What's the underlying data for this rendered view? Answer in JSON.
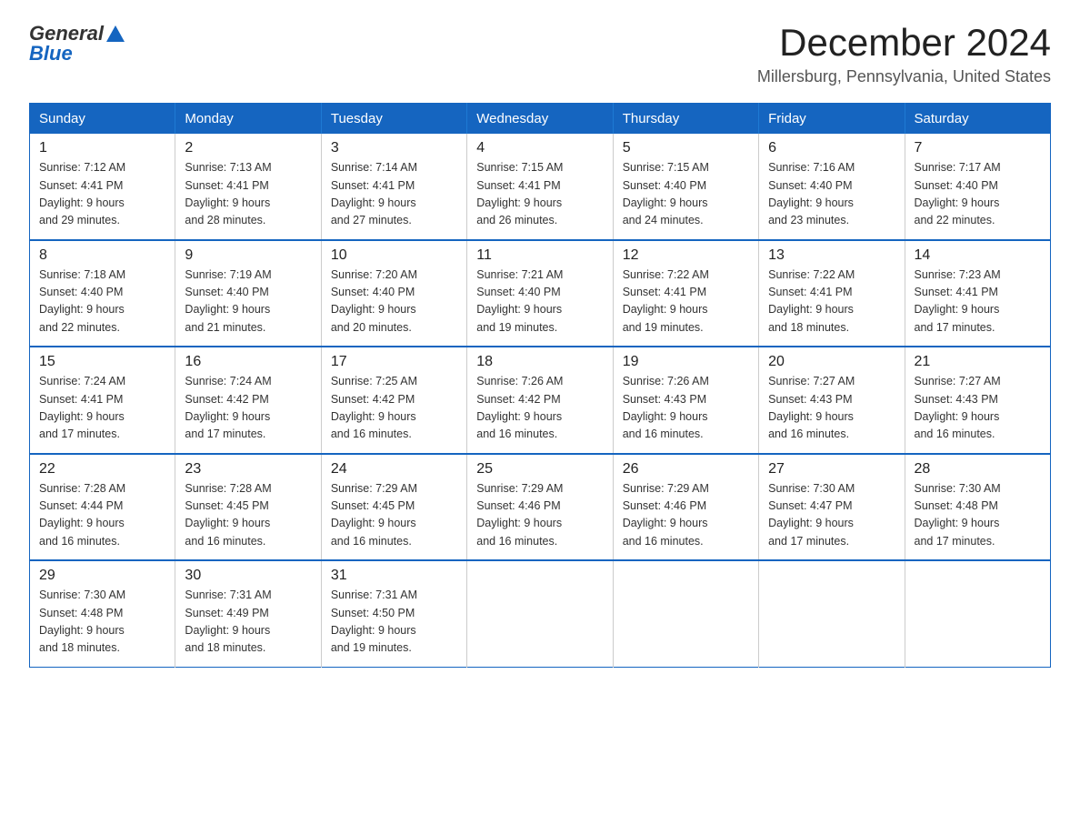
{
  "header": {
    "logo_text_general": "General",
    "logo_text_blue": "Blue",
    "title": "December 2024",
    "subtitle": "Millersburg, Pennsylvania, United States"
  },
  "days_of_week": [
    "Sunday",
    "Monday",
    "Tuesday",
    "Wednesday",
    "Thursday",
    "Friday",
    "Saturday"
  ],
  "weeks": [
    [
      {
        "day": "1",
        "sunrise": "7:12 AM",
        "sunset": "4:41 PM",
        "daylight": "9 hours and 29 minutes."
      },
      {
        "day": "2",
        "sunrise": "7:13 AM",
        "sunset": "4:41 PM",
        "daylight": "9 hours and 28 minutes."
      },
      {
        "day": "3",
        "sunrise": "7:14 AM",
        "sunset": "4:41 PM",
        "daylight": "9 hours and 27 minutes."
      },
      {
        "day": "4",
        "sunrise": "7:15 AM",
        "sunset": "4:41 PM",
        "daylight": "9 hours and 26 minutes."
      },
      {
        "day": "5",
        "sunrise": "7:15 AM",
        "sunset": "4:40 PM",
        "daylight": "9 hours and 24 minutes."
      },
      {
        "day": "6",
        "sunrise": "7:16 AM",
        "sunset": "4:40 PM",
        "daylight": "9 hours and 23 minutes."
      },
      {
        "day": "7",
        "sunrise": "7:17 AM",
        "sunset": "4:40 PM",
        "daylight": "9 hours and 22 minutes."
      }
    ],
    [
      {
        "day": "8",
        "sunrise": "7:18 AM",
        "sunset": "4:40 PM",
        "daylight": "9 hours and 22 minutes."
      },
      {
        "day": "9",
        "sunrise": "7:19 AM",
        "sunset": "4:40 PM",
        "daylight": "9 hours and 21 minutes."
      },
      {
        "day": "10",
        "sunrise": "7:20 AM",
        "sunset": "4:40 PM",
        "daylight": "9 hours and 20 minutes."
      },
      {
        "day": "11",
        "sunrise": "7:21 AM",
        "sunset": "4:40 PM",
        "daylight": "9 hours and 19 minutes."
      },
      {
        "day": "12",
        "sunrise": "7:22 AM",
        "sunset": "4:41 PM",
        "daylight": "9 hours and 19 minutes."
      },
      {
        "day": "13",
        "sunrise": "7:22 AM",
        "sunset": "4:41 PM",
        "daylight": "9 hours and 18 minutes."
      },
      {
        "day": "14",
        "sunrise": "7:23 AM",
        "sunset": "4:41 PM",
        "daylight": "9 hours and 17 minutes."
      }
    ],
    [
      {
        "day": "15",
        "sunrise": "7:24 AM",
        "sunset": "4:41 PM",
        "daylight": "9 hours and 17 minutes."
      },
      {
        "day": "16",
        "sunrise": "7:24 AM",
        "sunset": "4:42 PM",
        "daylight": "9 hours and 17 minutes."
      },
      {
        "day": "17",
        "sunrise": "7:25 AM",
        "sunset": "4:42 PM",
        "daylight": "9 hours and 16 minutes."
      },
      {
        "day": "18",
        "sunrise": "7:26 AM",
        "sunset": "4:42 PM",
        "daylight": "9 hours and 16 minutes."
      },
      {
        "day": "19",
        "sunrise": "7:26 AM",
        "sunset": "4:43 PM",
        "daylight": "9 hours and 16 minutes."
      },
      {
        "day": "20",
        "sunrise": "7:27 AM",
        "sunset": "4:43 PM",
        "daylight": "9 hours and 16 minutes."
      },
      {
        "day": "21",
        "sunrise": "7:27 AM",
        "sunset": "4:43 PM",
        "daylight": "9 hours and 16 minutes."
      }
    ],
    [
      {
        "day": "22",
        "sunrise": "7:28 AM",
        "sunset": "4:44 PM",
        "daylight": "9 hours and 16 minutes."
      },
      {
        "day": "23",
        "sunrise": "7:28 AM",
        "sunset": "4:45 PM",
        "daylight": "9 hours and 16 minutes."
      },
      {
        "day": "24",
        "sunrise": "7:29 AM",
        "sunset": "4:45 PM",
        "daylight": "9 hours and 16 minutes."
      },
      {
        "day": "25",
        "sunrise": "7:29 AM",
        "sunset": "4:46 PM",
        "daylight": "9 hours and 16 minutes."
      },
      {
        "day": "26",
        "sunrise": "7:29 AM",
        "sunset": "4:46 PM",
        "daylight": "9 hours and 16 minutes."
      },
      {
        "day": "27",
        "sunrise": "7:30 AM",
        "sunset": "4:47 PM",
        "daylight": "9 hours and 17 minutes."
      },
      {
        "day": "28",
        "sunrise": "7:30 AM",
        "sunset": "4:48 PM",
        "daylight": "9 hours and 17 minutes."
      }
    ],
    [
      {
        "day": "29",
        "sunrise": "7:30 AM",
        "sunset": "4:48 PM",
        "daylight": "9 hours and 18 minutes."
      },
      {
        "day": "30",
        "sunrise": "7:31 AM",
        "sunset": "4:49 PM",
        "daylight": "9 hours and 18 minutes."
      },
      {
        "day": "31",
        "sunrise": "7:31 AM",
        "sunset": "4:50 PM",
        "daylight": "9 hours and 19 minutes."
      },
      null,
      null,
      null,
      null
    ]
  ],
  "labels": {
    "sunrise": "Sunrise:",
    "sunset": "Sunset:",
    "daylight": "Daylight:"
  }
}
